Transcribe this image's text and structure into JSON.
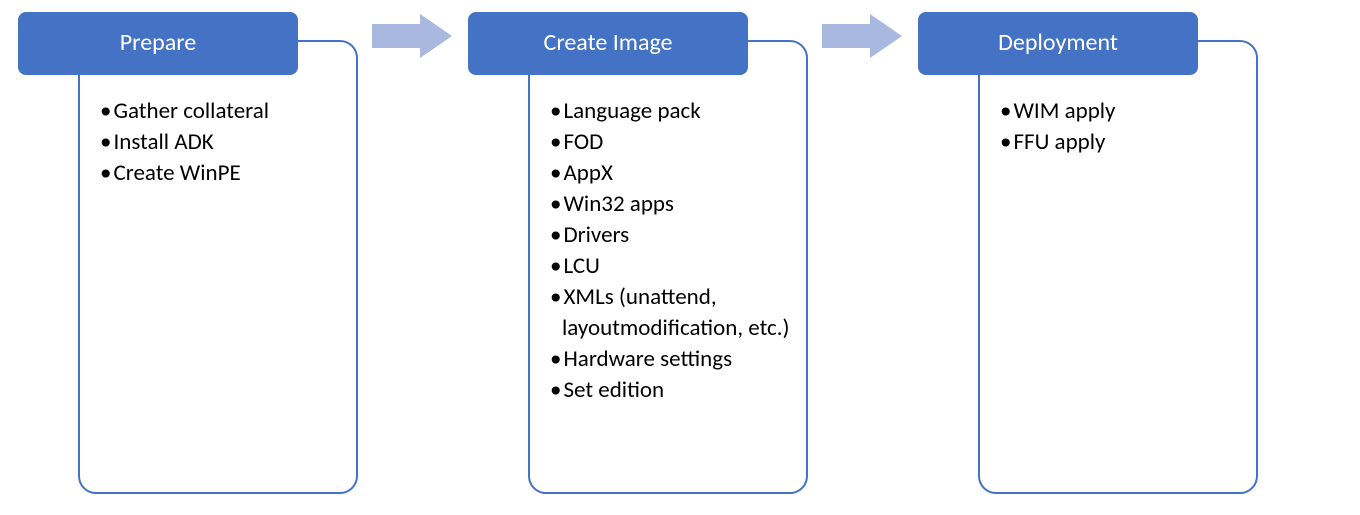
{
  "stages": [
    {
      "title": "Prepare",
      "items": [
        "Gather collateral",
        "Install ADK",
        "Create WinPE"
      ]
    },
    {
      "title": "Create Image",
      "items": [
        "Language pack",
        "FOD",
        "AppX",
        "Win32 apps",
        "Drivers",
        "LCU",
        "XMLs (unattend, layoutmodification, etc.)",
        "Hardware settings",
        "Set edition"
      ]
    },
    {
      "title": "Deployment",
      "items": [
        "WIM apply",
        "FFU apply"
      ]
    }
  ],
  "colors": {
    "primary": "#4472C4",
    "arrow": "#A9B8DE"
  }
}
